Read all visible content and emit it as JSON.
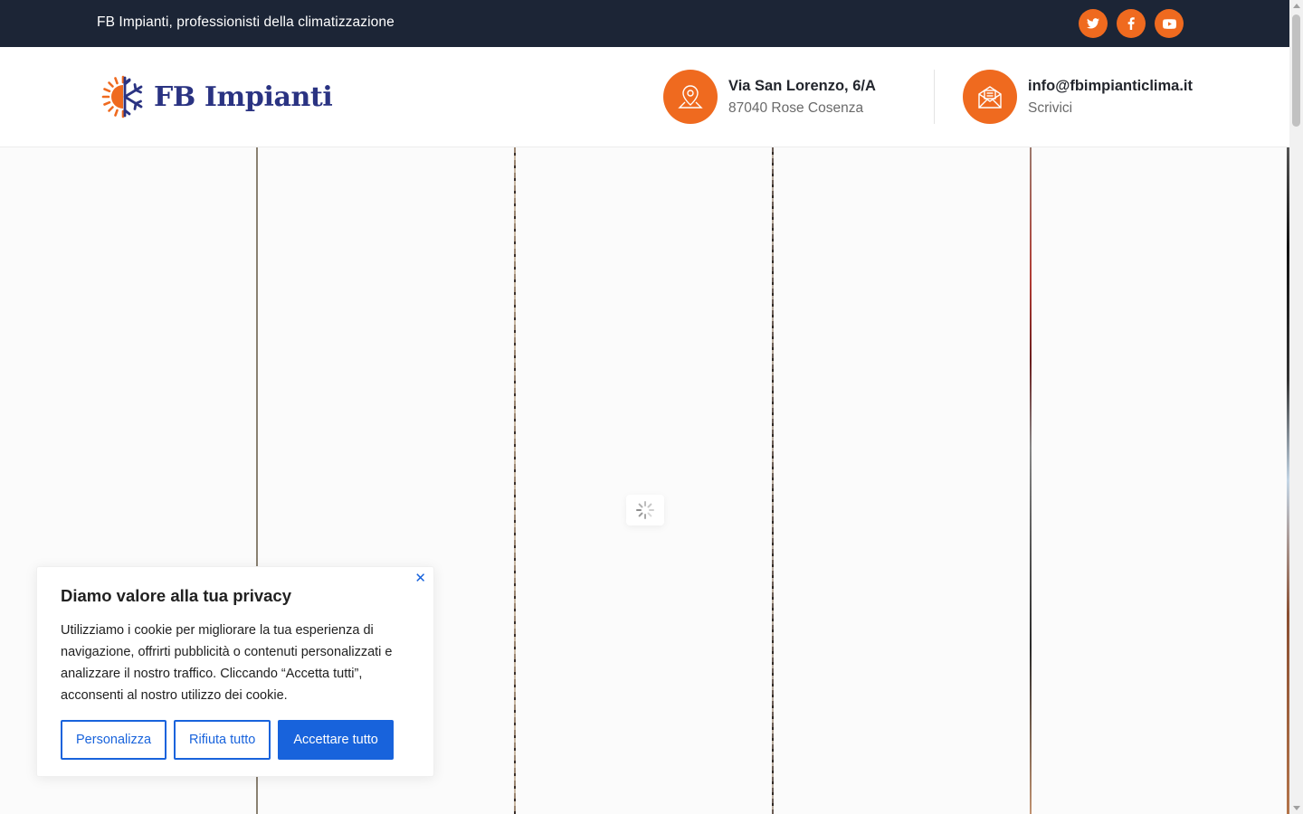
{
  "topbar": {
    "tagline": "FB Impianti, professionisti della climatizzazione",
    "socials": [
      {
        "icon": "twitter-icon"
      },
      {
        "icon": "facebook-icon"
      },
      {
        "icon": "youtube-icon"
      }
    ]
  },
  "header": {
    "logo_text": "FB Impianti",
    "address": {
      "title": "Via San Lorenzo, 6/A",
      "sub": "87040 Rose Cosenza",
      "icon": "map-pin-icon"
    },
    "email": {
      "title": "info@fbimpianticlima.it",
      "sub": "Scrivici",
      "icon": "envelope-icon"
    }
  },
  "cookie": {
    "title": "Diamo valore alla tua privacy",
    "text": "Utilizziamo i cookie per migliorare la tua esperienza di navigazione, offrirti pubblicità o contenuti personalizzati e analizzare il nostro traffico. Cliccando “Accetta tutti”, acconsenti al nostro utilizzo dei cookie.",
    "close": "✕",
    "customize": "Personalizza",
    "reject": "Rifiuta tutto",
    "accept": "Accettare tutto"
  },
  "colors": {
    "topbar_bg": "#1c2536",
    "accent": "#ef6a1f",
    "brand": "#2a3382",
    "cookie_button": "#1863dc"
  }
}
